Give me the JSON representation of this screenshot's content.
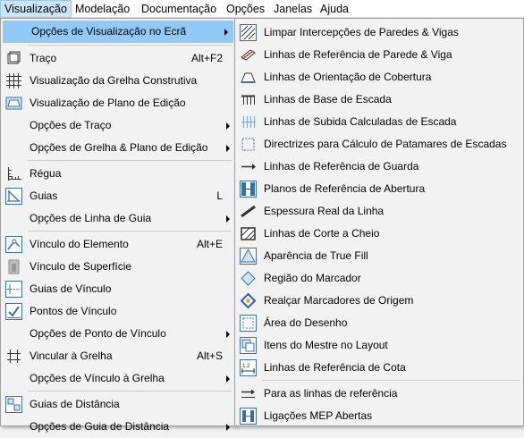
{
  "menubar": {
    "items": [
      "Visualização",
      "Modelação",
      "Documentação",
      "Opções",
      "Janelas",
      "Ajuda"
    ]
  },
  "main_menu": {
    "items": [
      {
        "label": "Opções de Visualização no Ecrã",
        "submenu": true,
        "highlighted": true
      },
      {
        "label": "Traço",
        "shortcut": "Alt+F2",
        "icon": "trace-icon"
      },
      {
        "label": "Visualização da Grelha Construtiva",
        "icon": "grid-icon"
      },
      {
        "label": "Visualização de Plano de Edição",
        "icon": "edit-plane-icon"
      },
      {
        "label": "Opções de Traço",
        "submenu": true
      },
      {
        "label": "Opções de Grelha & Plano de Edição",
        "submenu": true
      },
      {
        "label": "Régua",
        "icon": "ruler-icon"
      },
      {
        "label": "Guias",
        "shortcut": "L",
        "icon": "guides-icon"
      },
      {
        "label": "Opções de Linha de Guia",
        "submenu": true
      },
      {
        "label": "Vínculo do Elemento",
        "shortcut": "Alt+E",
        "icon": "element-snap-icon"
      },
      {
        "label": "Vínculo de Superfície",
        "icon": "surface-snap-icon"
      },
      {
        "label": "Guias de Vínculo",
        "icon": "snap-guides-icon"
      },
      {
        "label": "Pontos de Vínculo",
        "icon": "snap-points-icon"
      },
      {
        "label": "Opções de Ponto de Vínculo",
        "submenu": true
      },
      {
        "label": "Vincular à Grelha",
        "shortcut": "Alt+S",
        "icon": "snap-grid-icon"
      },
      {
        "label": "Opções de Vínculo à Grelha",
        "submenu": true
      },
      {
        "label": "Guias de Distância",
        "icon": "distance-guides-icon"
      },
      {
        "label": "Opções de Guia de Distância",
        "submenu": true
      }
    ]
  },
  "sub_menu": {
    "items": [
      {
        "label": "Limpar Intercepções de Paredes & Vigas",
        "icon": "clean-intersections-icon"
      },
      {
        "label": "Linhas de Referência de Parede & Viga",
        "icon": "wall-reference-line-icon"
      },
      {
        "label": "Linhas de Orientação de Cobertura",
        "icon": "roof-pivot-lines-icon"
      },
      {
        "label": "Linhas de Base de Escada",
        "icon": "stair-baseline-icon"
      },
      {
        "label": "Linhas de Subida Calculadas de Escada",
        "icon": "stair-walking-line-icon"
      },
      {
        "label": "Directrizes para Cálculo de Patamares de Escadas",
        "icon": "landing-guidelines-icon"
      },
      {
        "label": "Linhas de Referência de Guarda",
        "icon": "railing-reference-icon"
      },
      {
        "label": "Planos de Referência de Abertura",
        "icon": "opening-reference-icon"
      },
      {
        "label": "Espessura Real da Linha",
        "icon": "true-line-weight-icon"
      },
      {
        "label": "Linhas de Corte a Cheio",
        "icon": "bold-cut-lines-icon"
      },
      {
        "label": "Aparência de True Fill",
        "icon": "true-fill-icon"
      },
      {
        "label": "Região do Marcador",
        "icon": "marker-range-icon"
      },
      {
        "label": "Realçar Marcadores de Origem",
        "icon": "highlight-source-markers-icon"
      },
      {
        "label": "Área do Desenho",
        "icon": "drawing-frame-icon"
      },
      {
        "label": "Itens do Mestre no Layout",
        "icon": "master-items-icon"
      },
      {
        "label": "Linhas de Referência de Cota",
        "icon": "dimension-reference-icon"
      },
      {
        "label": "Para as linhas de referência",
        "icon": "to-reference-lines-icon"
      },
      {
        "label": "Ligações MEP Abertas",
        "icon": "open-mep-connections-icon"
      }
    ]
  },
  "colors": {
    "highlight": "#91c9f7",
    "icon_blue": "#3a6ea5"
  }
}
